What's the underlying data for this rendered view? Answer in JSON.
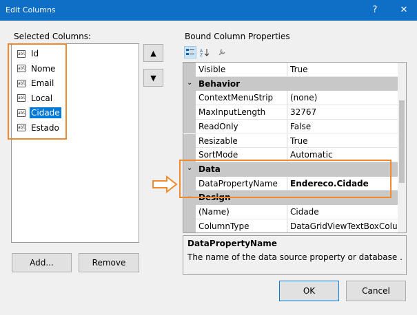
{
  "window": {
    "title": "Edit Columns",
    "help_glyph": "?",
    "close_glyph": "✕"
  },
  "selected_columns": {
    "label": "Selected Columns:",
    "items": [
      "Id",
      "Nome",
      "Email",
      "Local",
      "Cidade",
      "Estado"
    ],
    "selected": "Cidade",
    "item_icon_text": "abl"
  },
  "move": {
    "up_glyph": "▲",
    "down_glyph": "▼"
  },
  "buttons": {
    "add": "Add...",
    "remove": "Remove",
    "ok": "OK",
    "cancel": "Cancel"
  },
  "properties": {
    "label": "Bound Column Properties",
    "rows": [
      {
        "name": "Visible",
        "value": "True"
      },
      {
        "category": "Behavior"
      },
      {
        "name": "ContextMenuStrip",
        "value": "(none)"
      },
      {
        "name": "MaxInputLength",
        "value": "32767"
      },
      {
        "name": "ReadOnly",
        "value": "False"
      },
      {
        "name": "Resizable",
        "value": "True"
      },
      {
        "name": "SortMode",
        "value": "Automatic"
      },
      {
        "category": "Data"
      },
      {
        "name": "DataPropertyName",
        "value": "Endereco.Cidade"
      },
      {
        "category": "Design"
      },
      {
        "name": "(Name)",
        "value": "Cidade"
      },
      {
        "name": "ColumnType",
        "value": "DataGridViewTextBoxColu"
      }
    ]
  },
  "description": {
    "title": "DataPropertyName",
    "text": "The name of the data source property or database ..."
  },
  "colors": {
    "title_bar": "#0f6fc6",
    "highlight_box": "#f08a2c",
    "selection": "#0078d7"
  }
}
